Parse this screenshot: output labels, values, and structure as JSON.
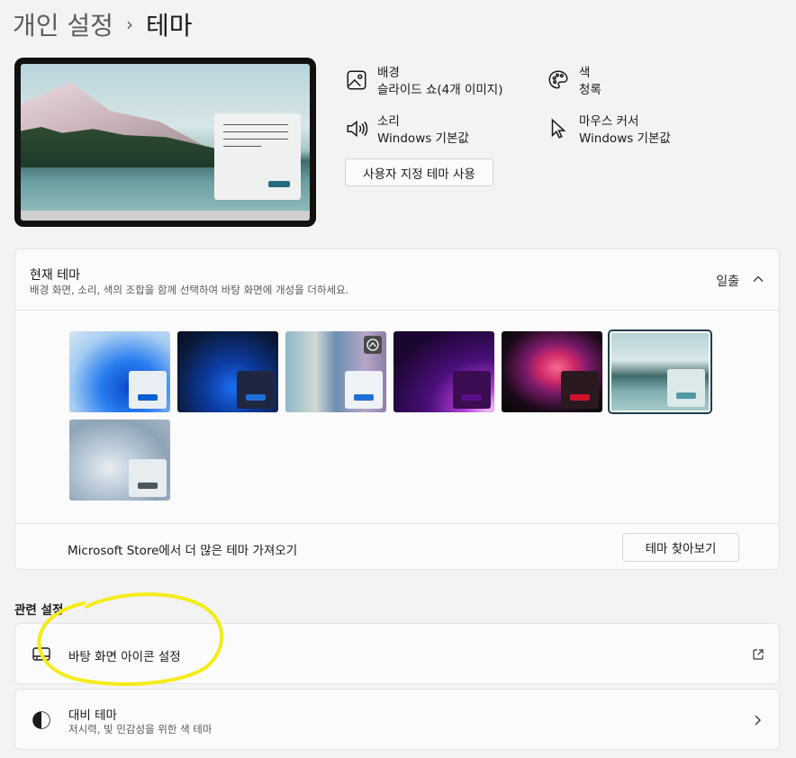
{
  "breadcrumb": {
    "parent": "개인 설정",
    "separator": "›",
    "current": "테마"
  },
  "summary": {
    "background": {
      "title": "배경",
      "value": "슬라이드 쇼(4개 이미지)",
      "icon": "image-icon"
    },
    "color": {
      "title": "색",
      "value": "청록",
      "icon": "palette-icon"
    },
    "sound": {
      "title": "소리",
      "value": "Windows 기본값",
      "icon": "speaker-icon"
    },
    "cursor": {
      "title": "마우스 커서",
      "value": "Windows 기본값",
      "icon": "cursor-icon"
    },
    "custom_theme_button": "사용자 지정 테마 사용"
  },
  "current_theme": {
    "title": "현재 테마",
    "description": "배경 화면, 소리, 색의 조합을 함께 선택하여 바탕 화면에 개성을 더하세요.",
    "value": "일출",
    "themes": [
      {
        "name": "windows-light",
        "accent": "#0a5fd1",
        "selected": false
      },
      {
        "name": "windows-dark",
        "accent": "#1f6fd6",
        "selected": false
      },
      {
        "name": "glow",
        "accent": "#1f6fd6",
        "selected": false
      },
      {
        "name": "captured-motion",
        "accent": "#5a0f8a",
        "selected": false
      },
      {
        "name": "flow",
        "accent": "#d0102a",
        "selected": false
      },
      {
        "name": "sunrise",
        "accent": "#4f9aa4",
        "selected": true
      },
      {
        "name": "windows-bloom-gray",
        "accent": "#4a5860",
        "selected": false
      }
    ],
    "store_text": "Microsoft Store에서 더 많은 테마 가져오기",
    "browse_button": "테마 찾아보기"
  },
  "related": {
    "title": "관련 설정",
    "desktop_icons": {
      "label": "바탕 화면 아이콘 설정",
      "icon": "monitor-icon",
      "action_icon": "external-link-icon"
    },
    "contrast": {
      "label": "대비 테마",
      "sub": "저시력, 빛 민감성을 위한 색 테마",
      "icon": "contrast-icon",
      "action_icon": "chevron-right-icon"
    }
  },
  "colors": {
    "annotation": "#f4ec1a",
    "accent": "#266c7d"
  }
}
